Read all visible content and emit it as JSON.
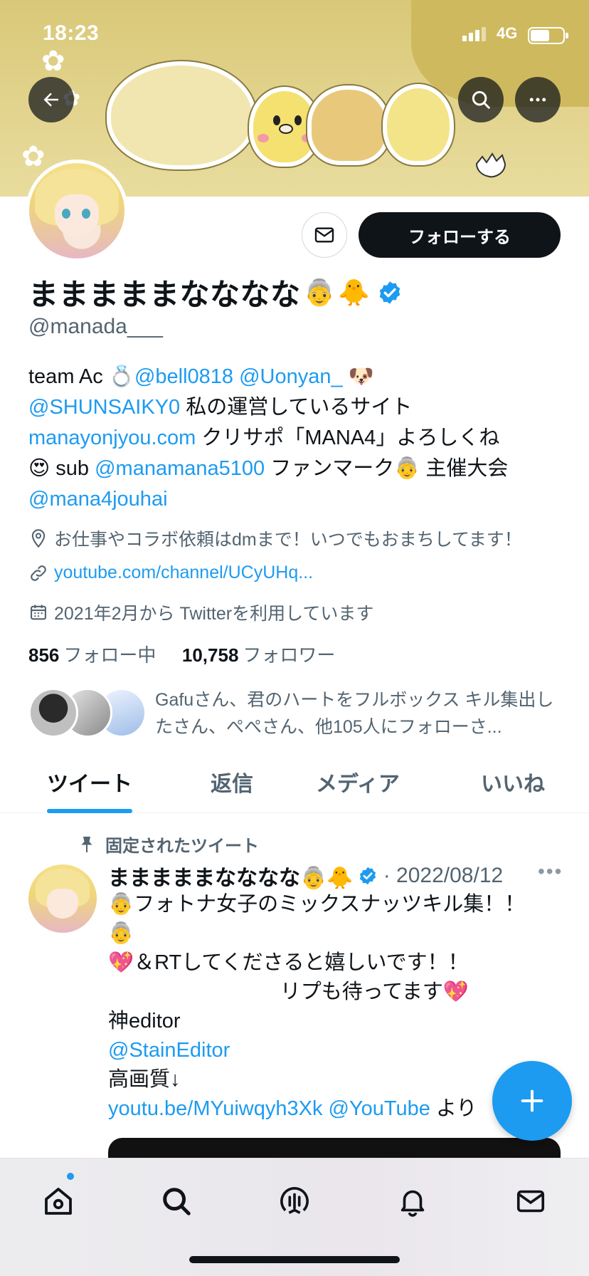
{
  "status_bar": {
    "time": "18:23",
    "network": "4G"
  },
  "profile": {
    "display_name": "まままままなななな",
    "name_emojis": [
      "👵",
      "🐥"
    ],
    "handle": "@manada___",
    "follow_label": "フォローする",
    "bio_lines": [
      [
        {
          "t": "team Ac 💍"
        },
        {
          "t": "@bell0818",
          "link": true
        },
        {
          "t": " "
        },
        {
          "t": "@Uonyan_",
          "link": true
        },
        {
          "t": " 🐶"
        }
      ],
      [
        {
          "t": "@SHUNSAIKY0",
          "link": true
        },
        {
          "t": " 私の運営しているサイト"
        }
      ],
      [
        {
          "t": "manayonjyou.com",
          "link": true
        },
        {
          "t": " クリサポ「MANA4」よろしくね"
        }
      ],
      [
        {
          "t": "😍 sub "
        },
        {
          "t": "@manamana5100",
          "link": true
        },
        {
          "t": " ファンマーク👵 主催大会"
        }
      ],
      [
        {
          "t": "@mana4jouhai",
          "link": true
        }
      ]
    ],
    "location": "お仕事やコラボ依頼はdmまで！いつでもおまちしてます！",
    "website": "youtube.com/channel/UCyUHq...",
    "joined": "2021年2月から Twitterを利用しています",
    "following_count": "856",
    "following_label": "フォロー中",
    "followers_count": "10,758",
    "followers_label": "フォロワー",
    "followed_by": "Gafuさん、君のハートをフルボックス キル集出したさん、ぺぺさん、他105人にフォローさ..."
  },
  "tabs": [
    {
      "label": "ツイート",
      "active": true
    },
    {
      "label": "返信",
      "active": false
    },
    {
      "label": "メディア",
      "active": false
    },
    {
      "label": "いいね",
      "active": false
    }
  ],
  "tweet": {
    "pinned_label": "固定されたツイート",
    "name": "まままままなななな👵🐥",
    "date": "· 2022/08/12",
    "body_lines": [
      [
        {
          "t": "👵フォトナ女子のミックスナッツキル集！！"
        }
      ],
      [
        {
          "t": "👵"
        }
      ],
      [
        {
          "t": "💖＆RTしてくださると嬉しいです！！"
        }
      ],
      [
        {
          "t": "                              リプも待ってます💖"
        }
      ],
      [
        {
          "t": "神editor"
        }
      ],
      [
        {
          "t": "@StainEditor",
          "link": true
        }
      ],
      [
        {
          "t": "高画質↓"
        }
      ],
      [
        {
          "t": "youtu.be/MYuiwqyh3Xk",
          "link": true
        },
        {
          "t": " "
        },
        {
          "t": "@YouTube",
          "link": true
        },
        {
          "t": " より"
        }
      ]
    ]
  },
  "colors": {
    "accent": "#1d9bf0",
    "text": "#0f1419",
    "secondary": "#536471",
    "follow_button": "#0f1419"
  },
  "icons": {
    "back": "arrow-left-icon",
    "search": "search-icon",
    "more": "more-horizontal-icon",
    "dm": "envelope-icon",
    "verified": "verified-badge-icon",
    "location": "location-pin-icon",
    "link": "link-icon",
    "calendar": "calendar-icon",
    "pin": "pin-icon",
    "compose": "plus-icon",
    "nav_home": "home-icon",
    "nav_search": "search-icon",
    "nav_spaces": "spaces-icon",
    "nav_notifications": "bell-icon",
    "nav_messages": "envelope-icon"
  }
}
